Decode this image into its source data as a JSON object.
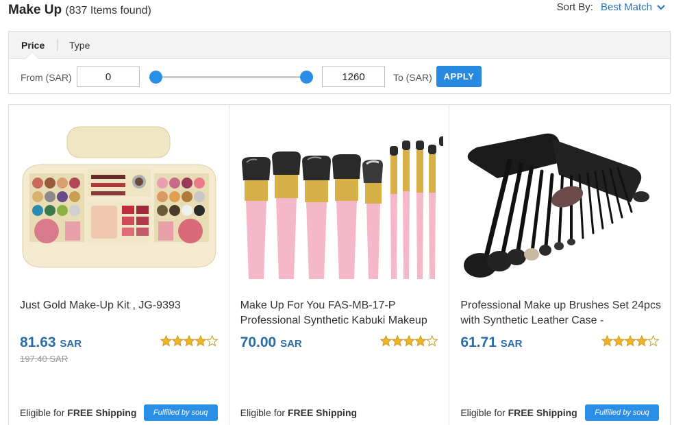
{
  "header": {
    "title": "Make Up",
    "count": "(837 Items found)",
    "sort_label": "Sort By:",
    "sort_value": "Best Match"
  },
  "filters": {
    "tabs": [
      {
        "label": "Price"
      },
      {
        "label": "Type"
      }
    ],
    "from_label": "From (SAR)",
    "from_value": "0",
    "to_label": "To (SAR)",
    "to_value": "1260",
    "apply_label": "APPLY"
  },
  "products": [
    {
      "title": "Just Gold Make-Up Kit , JG-9393",
      "price": "81.63",
      "currency": "SAR",
      "old_price": "197.40 SAR",
      "rating": 4,
      "shipping_prefix": "Eligible for",
      "shipping_bold": "FREE Shipping",
      "badge": "Fulfilled by souq"
    },
    {
      "title": "Make Up For You FAS-MB-17-P Professional Synthetic Kabuki Makeup",
      "price": "70.00",
      "currency": "SAR",
      "old_price": "",
      "rating": 4,
      "shipping_prefix": "Eligible for",
      "shipping_bold": "FREE Shipping",
      "badge": ""
    },
    {
      "title": "Professional Make up Brushes Set 24pcs with Synthetic Leather Case -",
      "price": "61.71",
      "currency": "SAR",
      "old_price": "",
      "rating": 4,
      "shipping_prefix": "Eligible for",
      "shipping_bold": "FREE Shipping",
      "badge": "Fulfilled by souq"
    }
  ],
  "colors": {
    "accent_blue": "#2889e0",
    "price_blue": "#2a6ca8",
    "star_gold": "#f0b428"
  }
}
